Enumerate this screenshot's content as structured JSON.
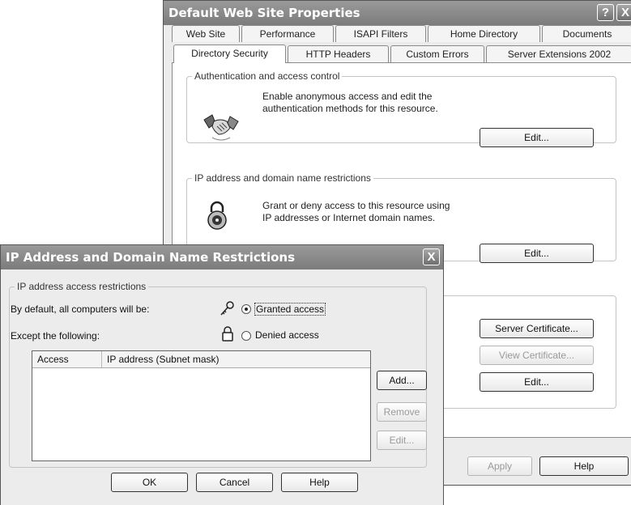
{
  "properties_window": {
    "title": "Default Web Site Properties",
    "help_icon": "?",
    "close_icon": "X",
    "tabs_row1": [
      "Web Site",
      "Performance",
      "ISAPI Filters",
      "Home Directory",
      "Documents"
    ],
    "tabs_row2": [
      "Directory Security",
      "HTTP Headers",
      "Custom Errors",
      "Server Extensions 2002"
    ],
    "auth": {
      "legend": "Authentication and access control",
      "text1": "Enable anonymous access and edit the",
      "text2": "authentication methods for this resource.",
      "edit_button": "Edit..."
    },
    "ip": {
      "legend": "IP address and domain name restrictions",
      "text1": "Grant or deny access to this resource using",
      "text2": "IP addresses or Internet domain names.",
      "edit_button": "Edit..."
    },
    "secure": {
      "server_cert_button": "Server Certificate...",
      "view_cert_button": "View Certificate...",
      "edit_button": "Edit..."
    },
    "apply_button": "Apply",
    "help_button": "Help"
  },
  "dialog": {
    "title": "IP Address and Domain Name Restrictions",
    "close_icon": "X",
    "group_legend": "IP address access restrictions",
    "default_label": "By default, all computers will be:",
    "granted_label": "Granted access",
    "except_label": "Except the following:",
    "denied_label": "Denied access",
    "selected_option": "granted",
    "columns": [
      "Access",
      "IP address (Subnet mask)"
    ],
    "add_button": "Add...",
    "remove_button": "Remove",
    "edit_button": "Edit...",
    "ok_button": "OK",
    "cancel_button": "Cancel",
    "help_button": "Help"
  }
}
